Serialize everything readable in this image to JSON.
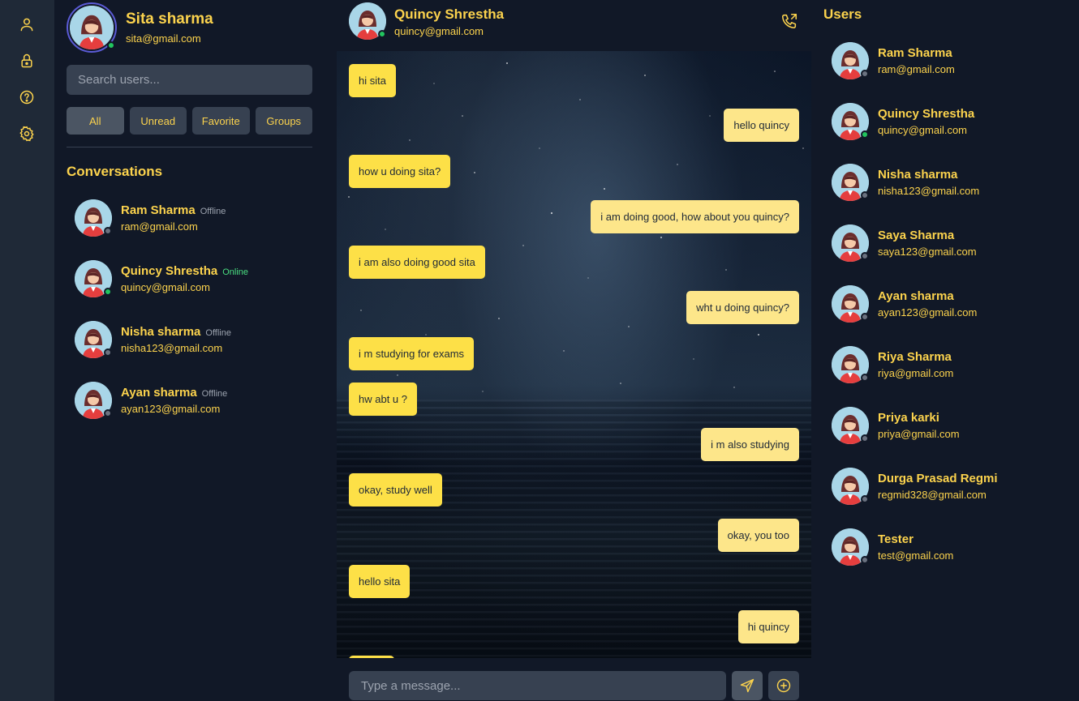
{
  "rail": {
    "icons": [
      "user-icon",
      "lock-icon",
      "help-icon",
      "settings-icon"
    ]
  },
  "me": {
    "name": "Sita sharma",
    "email": "sita@gmail.com",
    "status_color": "#22c55e"
  },
  "search": {
    "placeholder": "Search users..."
  },
  "filters": [
    "All",
    "Unread",
    "Favorite",
    "Groups"
  ],
  "conversations_title": "Conversations",
  "conversations": [
    {
      "name": "Ram Sharma",
      "status": "Offline",
      "email": "ram@gmail.com"
    },
    {
      "name": "Quincy Shrestha",
      "status": "Online",
      "email": "quincy@gmail.com"
    },
    {
      "name": "Nisha sharma",
      "status": "Offline",
      "email": "nisha123@gmail.com"
    },
    {
      "name": "Ayan sharma",
      "status": "Offline",
      "email": "ayan123@gmail.com"
    }
  ],
  "chat": {
    "contact_name": "Quincy Shrestha",
    "contact_email": "quincy@gmail.com",
    "messages": [
      {
        "text": "hi sita",
        "dir": "in"
      },
      {
        "text": "hello quincy",
        "dir": "out"
      },
      {
        "text": "how u doing sita?",
        "dir": "in"
      },
      {
        "text": "i am doing good, how about you quincy?",
        "dir": "out"
      },
      {
        "text": "i am also doing good sita",
        "dir": "in"
      },
      {
        "text": "wht u doing quincy?",
        "dir": "out"
      },
      {
        "text": "i m studying for exams",
        "dir": "in"
      },
      {
        "text": "hw abt u ?",
        "dir": "in"
      },
      {
        "text": "i m also studying",
        "dir": "out"
      },
      {
        "text": "okay, study well",
        "dir": "in"
      },
      {
        "text": "okay, you too",
        "dir": "out"
      },
      {
        "text": "hello sita",
        "dir": "in"
      },
      {
        "text": "hi quincy",
        "dir": "out"
      }
    ],
    "input_placeholder": "Type a message..."
  },
  "users_title": "Users",
  "users": [
    {
      "name": "Ram Sharma",
      "email": "ram@gmail.com",
      "online": false
    },
    {
      "name": "Quincy Shrestha",
      "email": "quincy@gmail.com",
      "online": true
    },
    {
      "name": "Nisha sharma",
      "email": "nisha123@gmail.com",
      "online": false
    },
    {
      "name": "Saya Sharma",
      "email": "saya123@gmail.com",
      "online": false
    },
    {
      "name": "Ayan sharma",
      "email": "ayan123@gmail.com",
      "online": false
    },
    {
      "name": "Riya Sharma",
      "email": "riya@gmail.com",
      "online": false
    },
    {
      "name": "Priya karki",
      "email": "priya@gmail.com",
      "online": false
    },
    {
      "name": "Durga Prasad Regmi",
      "email": "regmid328@gmail.com",
      "online": false
    },
    {
      "name": "Tester",
      "email": "test@gmail.com",
      "online": false
    }
  ],
  "colors": {
    "accent": "#fcd34d",
    "online": "#22c55e",
    "offline": "#6b7280",
    "bubble_in": "#fde047",
    "bubble_out": "#fde68a"
  }
}
